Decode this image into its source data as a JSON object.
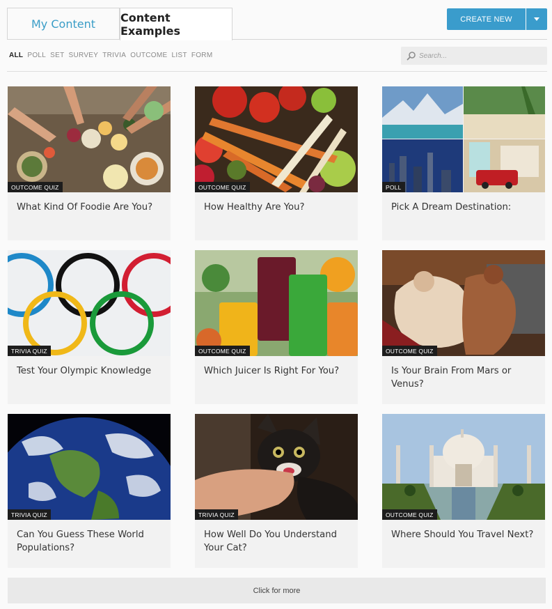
{
  "tabs": [
    {
      "label": "My Content"
    },
    {
      "label": "Content Examples"
    }
  ],
  "create_button": {
    "label": "CREATE NEW"
  },
  "filters": [
    "ALL",
    "POLL",
    "SET",
    "SURVEY",
    "TRIVIA",
    "OUTCOME",
    "LIST",
    "FORM"
  ],
  "search": {
    "placeholder": "Search..."
  },
  "cards": [
    {
      "badge": "OUTCOME QUIZ",
      "title": "What Kind Of Foodie Are You?",
      "image": "food-table-photo"
    },
    {
      "badge": "OUTCOME QUIZ",
      "title": "How Healthy Are You?",
      "image": "vegetables-photo"
    },
    {
      "badge": "POLL",
      "title": "Pick A Dream Destination:",
      "image": "destinations-collage"
    },
    {
      "badge": "TRIVIA QUIZ",
      "title": "Test Your Olympic Knowledge",
      "image": "olympic-rings"
    },
    {
      "badge": "OUTCOME QUIZ",
      "title": "Which Juicer Is Right For You?",
      "image": "juices-photo"
    },
    {
      "badge": "OUTCOME QUIZ",
      "title": "Is Your Brain From Mars or Venus?",
      "image": "classical-painting"
    },
    {
      "badge": "TRIVIA QUIZ",
      "title": "Can You Guess These World Populations?",
      "image": "earth-globe"
    },
    {
      "badge": "TRIVIA QUIZ",
      "title": "How Well Do You Understand Your Cat?",
      "image": "kitten-photo"
    },
    {
      "badge": "OUTCOME QUIZ",
      "title": "Where Should You Travel Next?",
      "image": "taj-mahal-photo"
    }
  ],
  "more": {
    "label": "Click for more"
  },
  "colors": {
    "accent": "#3a9ccc",
    "badge_bg": "#1d1d1d"
  }
}
